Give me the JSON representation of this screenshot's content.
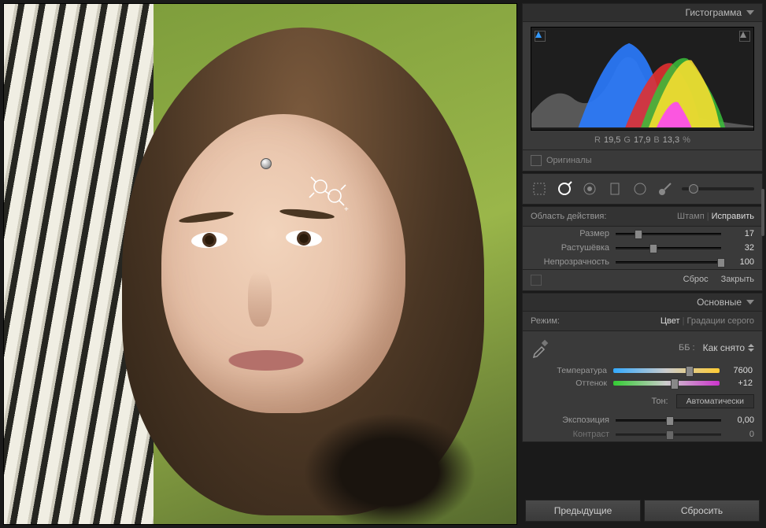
{
  "histogram": {
    "title": "Гистограмма",
    "rgb": {
      "rLabel": "R",
      "r": "19,5",
      "gLabel": "G",
      "g": "17,9",
      "bLabel": "B",
      "b": "13,3",
      "pct": "%"
    },
    "originals": "Оригиналы"
  },
  "spot": {
    "areaLabel": "Область действия:",
    "clone": "Штамп",
    "heal": "Исправить",
    "size": {
      "label": "Размер",
      "value": "17"
    },
    "feather": {
      "label": "Растушёвка",
      "value": "32"
    },
    "opacity": {
      "label": "Непрозрачность",
      "value": "100"
    },
    "reset": "Сброс",
    "close": "Закрыть"
  },
  "basic": {
    "title": "Основные",
    "treatLabel": "Режим:",
    "color": "Цвет",
    "gray": "Градации серого",
    "wbLabel": "ББ :",
    "wbPreset": "Как снято",
    "temp": {
      "label": "Температура",
      "value": "7600"
    },
    "tint": {
      "label": "Оттенок",
      "value": "+12"
    },
    "toneLabel": "Тон:",
    "auto": "Автоматически",
    "exposure": {
      "label": "Экспозиция",
      "value": "0,00"
    },
    "contrast": {
      "label": "Контраст",
      "value": "0"
    }
  },
  "footer": {
    "prev": "Предыдущие",
    "reset": "Сбросить"
  }
}
